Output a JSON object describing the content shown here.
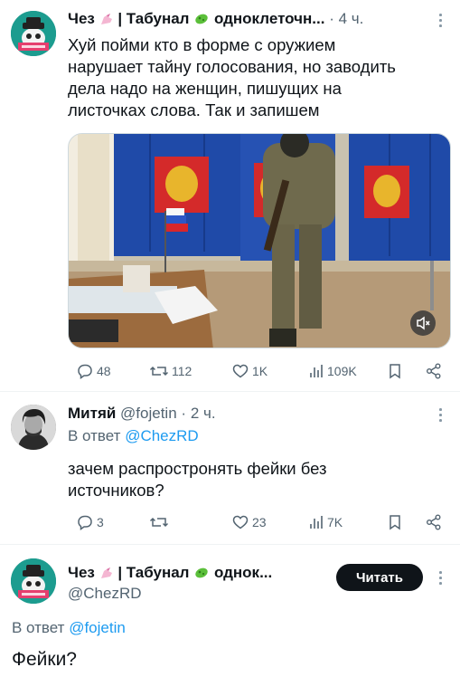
{
  "tweet1": {
    "name": "Чез",
    "name_rest": "| Табунал",
    "name_tail": "одноклеточн...",
    "time_sep": "·",
    "time": "4 ч.",
    "text": "Хуй пойми кто в форме с оружием\nнарушает тайну голосования, но заводить\nдела надо на женщин, пишущих на\nлисточках слова. Так и запишем",
    "media_mute_icon": "mute-icon",
    "stats": {
      "replies": "48",
      "retweets": "112",
      "likes": "1K",
      "views": "109K"
    }
  },
  "tweet2": {
    "name": "Митяй",
    "handle": "@fojetin",
    "time_sep": "·",
    "time": "2 ч.",
    "reply_prefix": "В ответ",
    "reply_mention": "@ChezRD",
    "text": "зачем распростронять фейки без\nисточников?",
    "stats": {
      "replies": "3",
      "retweets": "",
      "likes": "23",
      "views": "7K"
    }
  },
  "tweet3": {
    "name": "Чез",
    "name_rest": "| Табунал",
    "name_tail": "однок...",
    "handle": "@ChezRD",
    "read_button": "Читать",
    "reply_prefix": "В ответ",
    "reply_mention": "@fojetin",
    "text": "Фейки?"
  },
  "colors": {
    "accent": "#1d9bf0",
    "text": "#0f1419",
    "secondary": "#536471",
    "button": "#0f1419"
  }
}
